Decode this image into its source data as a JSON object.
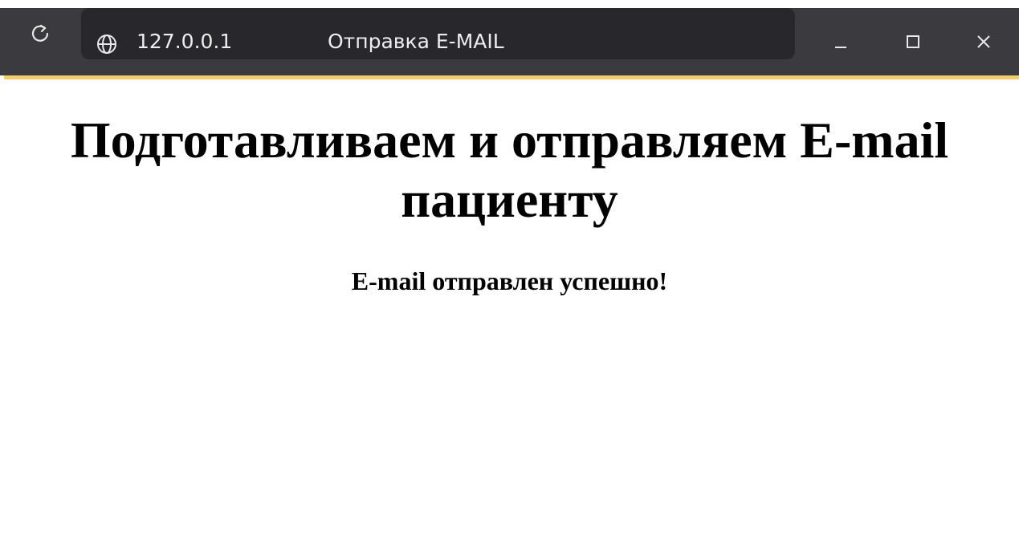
{
  "browser": {
    "url": "127.0.0.1",
    "tab_title": "Отправка E-MAIL",
    "icons": {
      "reload": "reload-icon",
      "site": "globe-icon",
      "minimize": "minimize-icon",
      "maximize": "maximize-icon",
      "close": "close-icon"
    },
    "colors": {
      "toolbar": "#3a3a3f",
      "address_bar": "#28282c",
      "accent": "#f2cf6c",
      "text": "#ededed"
    }
  },
  "page": {
    "title": "Подготавливаем и отправляем E-mail пациенту",
    "status": "E-mail отправлен успешно!"
  }
}
